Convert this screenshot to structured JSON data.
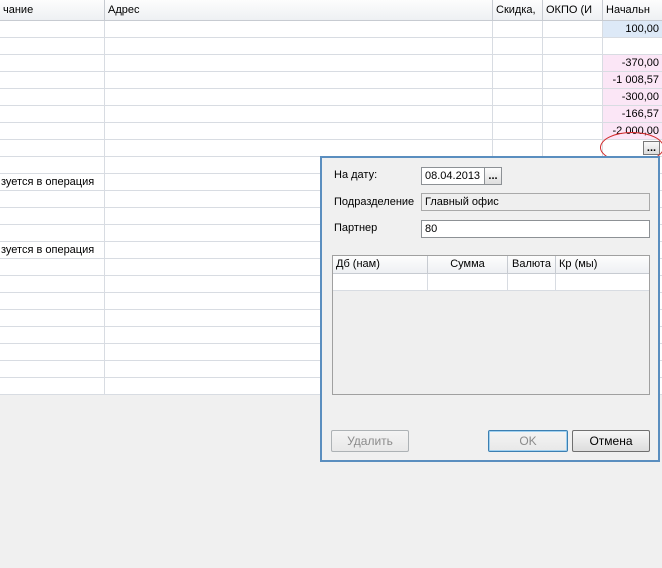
{
  "grid": {
    "columns": [
      "чание",
      "Адрес",
      "Скидка,",
      "ОКПО (И",
      "Начальн"
    ],
    "rows": [
      {
        "name": "",
        "addr": "",
        "disc": "",
        "okpo": "",
        "init": "100,00",
        "tone": "blue"
      },
      {
        "name": "",
        "addr": "",
        "disc": "",
        "okpo": "",
        "init": "",
        "tone": ""
      },
      {
        "name": "",
        "addr": "",
        "disc": "",
        "okpo": "",
        "init": "-370,00",
        "tone": "pink"
      },
      {
        "name": "",
        "addr": "",
        "disc": "",
        "okpo": "",
        "init": "-1 008,57",
        "tone": "pink"
      },
      {
        "name": "",
        "addr": "",
        "disc": "",
        "okpo": "",
        "init": "-300,00",
        "tone": "pink"
      },
      {
        "name": "",
        "addr": "",
        "disc": "",
        "okpo": "",
        "init": "-166,57",
        "tone": "pink"
      },
      {
        "name": "",
        "addr": "",
        "disc": "",
        "okpo": "",
        "init": "-2 000,00",
        "tone": "pink"
      },
      {
        "name": "",
        "addr": "",
        "disc": "",
        "okpo": "",
        "init": "",
        "tone": "edit"
      },
      {
        "name": "",
        "addr": "",
        "disc": "",
        "okpo": "",
        "init": "",
        "tone": ""
      },
      {
        "name": "зуется в операция",
        "addr": "",
        "disc": "",
        "okpo": "",
        "init": "",
        "tone": ""
      },
      {
        "name": "",
        "addr": "",
        "disc": "",
        "okpo": "",
        "init": "",
        "tone": ""
      },
      {
        "name": "",
        "addr": "",
        "disc": "",
        "okpo": "",
        "init": "",
        "tone": ""
      },
      {
        "name": "",
        "addr": "",
        "disc": "",
        "okpo": "",
        "init": "",
        "tone": ""
      },
      {
        "name": "зуется в операция",
        "addr": "",
        "disc": "",
        "okpo": "",
        "init": "",
        "tone": ""
      },
      {
        "name": "",
        "addr": "",
        "disc": "",
        "okpo": "",
        "init": "",
        "tone": ""
      },
      {
        "name": "",
        "addr": "",
        "disc": "",
        "okpo": "",
        "init": "",
        "tone": ""
      },
      {
        "name": "",
        "addr": "",
        "disc": "",
        "okpo": "",
        "init": "",
        "tone": ""
      },
      {
        "name": "",
        "addr": "",
        "disc": "",
        "okpo": "",
        "init": "",
        "tone": ""
      },
      {
        "name": "",
        "addr": "",
        "disc": "",
        "okpo": "",
        "init": "",
        "tone": ""
      },
      {
        "name": "",
        "addr": "",
        "disc": "",
        "okpo": "",
        "init": "",
        "tone": ""
      },
      {
        "name": "",
        "addr": "",
        "disc": "",
        "okpo": "",
        "init": "",
        "tone": ""
      },
      {
        "name": "",
        "addr": "",
        "disc": "",
        "okpo": "",
        "init": "",
        "tone": ""
      }
    ],
    "edit_button": "..."
  },
  "dialog": {
    "date_label": "На дату:",
    "date_value": "08.04.2013",
    "date_button": "...",
    "division_label": "Подразделение",
    "division_value": "Главный офис",
    "partner_label": "Партнер",
    "partner_value": "80",
    "table_columns": [
      "Дб (нам)",
      "Сумма",
      "Валюта",
      "Кр (мы)"
    ],
    "delete_button": "Удалить",
    "ok_button": "OK",
    "cancel_button": "Отмена"
  },
  "colors": {
    "positive_value_bg": "#dde9f7",
    "negative_value_bg": "#fbe6f6",
    "dialog_border": "#5a8ebf",
    "annotation": "#d22a2a"
  }
}
